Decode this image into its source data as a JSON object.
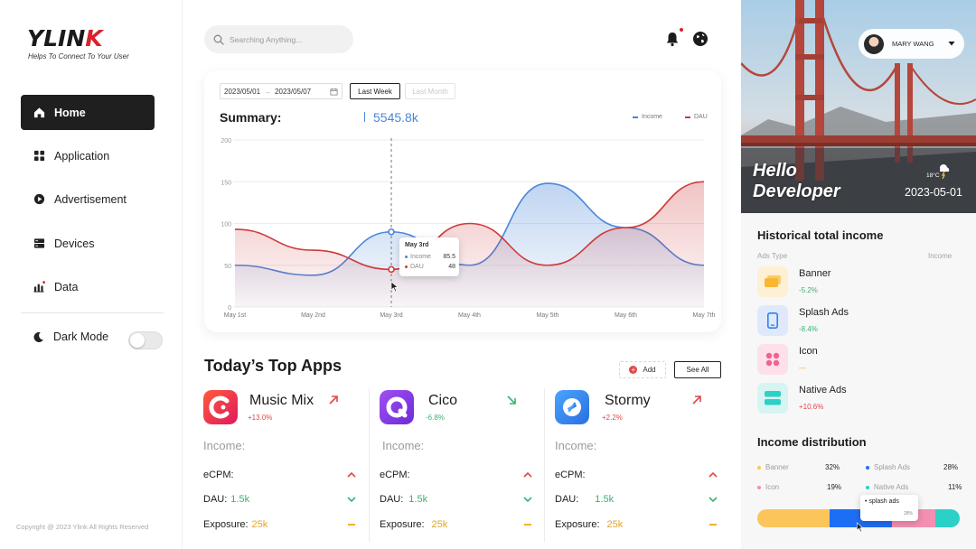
{
  "brand": {
    "logo_main": "YLIN",
    "logo_accent": "K",
    "tagline": "Helps To Connect To Your User"
  },
  "sidebar": {
    "items": [
      {
        "label": "Home",
        "icon": "home-icon",
        "active": true
      },
      {
        "label": "Application",
        "icon": "grid-icon",
        "active": false
      },
      {
        "label": "Advertisement",
        "icon": "play-icon",
        "active": false
      },
      {
        "label": "Devices",
        "icon": "devices-icon",
        "active": false
      },
      {
        "label": "Data",
        "icon": "bar-chart-icon",
        "active": false
      }
    ],
    "dark_mode_label": "Dark Mode",
    "dark_mode_on": false,
    "copyright": "Copyright @ 2023 Ylink All Rights Reserved"
  },
  "search": {
    "placeholder": "Searching Anything..."
  },
  "summary": {
    "date_from": "2023/05/01",
    "date_to": "2023/05/07",
    "week_label": "Last Week",
    "month_label": "Last Month",
    "title": "Summary:",
    "value": "5545.8k",
    "legend_income": "Income",
    "legend_dau": "DAU",
    "tooltip": {
      "title": "May 3rd",
      "income_label": "Income",
      "income_value": "85.5",
      "dau_label": "DAU",
      "dau_value": "48"
    }
  },
  "chart_data": {
    "type": "area",
    "x": [
      "May 1st",
      "May 2nd",
      "May 3rd",
      "May 4th",
      "May 5th",
      "May 6th",
      "May 7th"
    ],
    "yticks": [
      "0",
      "50",
      "100",
      "150",
      "200"
    ],
    "ylim": [
      0,
      200
    ],
    "series": [
      {
        "name": "Income",
        "color": "#4a86d8",
        "values": [
          50,
          38,
          90,
          50,
          148,
          95,
          50
        ]
      },
      {
        "name": "DAU",
        "color": "#cf3a3a",
        "values": [
          93,
          68,
          45,
          100,
          50,
          95,
          150
        ]
      }
    ],
    "hover_index": 2
  },
  "top_apps": {
    "title": "Today’s Top Apps",
    "add_label": "Add",
    "see_all_label": "See All",
    "income_label": "Income:",
    "apps": [
      {
        "name": "Music Mix",
        "change": "+13.0%",
        "trend": "up",
        "icon": "music-mix-icon",
        "metrics": [
          {
            "label": "eCPM:",
            "value": "",
            "status": "up"
          },
          {
            "label": "DAU:",
            "value": "1.5k",
            "status": "down"
          },
          {
            "label": "Exposure:",
            "value": "25k",
            "status": "flat"
          }
        ]
      },
      {
        "name": "Cico",
        "change": "-6.8%",
        "trend": "down",
        "icon": "cico-icon",
        "metrics": [
          {
            "label": "eCPM:",
            "value": "",
            "status": "up"
          },
          {
            "label": "DAU:",
            "value": "1.5k",
            "status": "down"
          },
          {
            "label": "Exposure:",
            "value": "25k",
            "status": "flat"
          }
        ]
      },
      {
        "name": "Stormy",
        "change": "+2.2%",
        "trend": "up",
        "icon": "stormy-icon",
        "metrics": [
          {
            "label": "eCPM:",
            "value": "",
            "status": "up"
          },
          {
            "label": "DAU:",
            "value": "1.5k",
            "status": "down"
          },
          {
            "label": "Exposure:",
            "value": "25k",
            "status": "flat"
          }
        ]
      }
    ]
  },
  "header": {
    "user_name": "MARY WANG"
  },
  "hero": {
    "line1": "Hello",
    "line2": "Developer",
    "temp": "18°C",
    "date": "2023-05-01"
  },
  "historical": {
    "title": "Historical total income",
    "col_left": "Ads Type",
    "col_right": "Income",
    "items": [
      {
        "name": "Banner",
        "change": "-5.2%",
        "color": "#f7b733"
      },
      {
        "name": "Splash Ads",
        "change": "-8.4%",
        "color": "#2f80ed"
      },
      {
        "name": "Icon",
        "change": "---",
        "color": "#f06292"
      },
      {
        "name": "Native Ads",
        "change": "+10.6%",
        "color": "#2bd1c6"
      }
    ]
  },
  "distribution": {
    "title": "Income distribution",
    "items": [
      {
        "name": "Banner",
        "pct": "32%",
        "value": 32,
        "color": "#fcc55c"
      },
      {
        "name": "Splash Ads",
        "pct": "28%",
        "value": 28,
        "color": "#1e6ef5"
      },
      {
        "name": "Icon",
        "pct": "19%",
        "value": 19,
        "color": "#f48fb1"
      },
      {
        "name": "Native Ads",
        "pct": "11%",
        "value": 11,
        "color": "#2bd1c6"
      }
    ],
    "tooltip_label": "splash ads",
    "tooltip_value": "28%"
  }
}
